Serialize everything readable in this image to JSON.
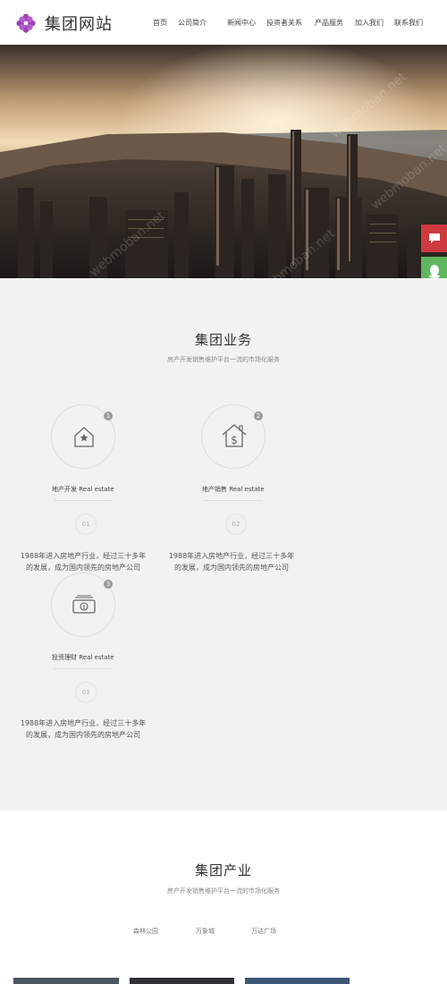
{
  "header": {
    "logo_text": "集团网站",
    "nav": [
      {
        "label": "首页"
      },
      {
        "label": "公司简介"
      },
      {
        "label": "新闻中心"
      },
      {
        "label": "投资者关系"
      },
      {
        "label": "产品服务"
      },
      {
        "label": "加入我们"
      },
      {
        "label": "联系我们"
      }
    ]
  },
  "banner": {
    "watermark": "webmoban.net"
  },
  "business": {
    "title": "集团业务",
    "subtitle": "房产开发销售维护平台一流的市场化服务",
    "cards": [
      {
        "badge": "1",
        "title": "地产开发 Real estate",
        "num": "01",
        "desc_line1": "1988年进入房地产行业，经过三十多年",
        "desc_line2": "的发展，成为国内领先的房地产公司",
        "icon": "house-star-icon"
      },
      {
        "badge": "2",
        "title": "地产销售 Real estate",
        "num": "02",
        "desc_line1": "1988年进入房地产行业，经过三十多年",
        "desc_line2": "的发展，成为国内领先的房地产公司",
        "icon": "house-dollar-icon"
      },
      {
        "badge": "3",
        "title": "投资理财 Real estate",
        "num": "03",
        "desc_line1": "1988年进入房地产行业，经过三十多年",
        "desc_line2": "的发展，成为国内领先的房地产公司",
        "icon": "money-icon"
      }
    ]
  },
  "industry": {
    "title": "集团产业",
    "subtitle": "房产开发销售维护平台一流的市场化服务",
    "tabs": [
      {
        "label": "森林公园"
      },
      {
        "label": "万象城"
      },
      {
        "label": "万达广场"
      }
    ]
  },
  "colors": {
    "accent_red": "#cd3b40",
    "accent_green": "#5fb65f",
    "logo_purple": "#9b3fb5"
  }
}
